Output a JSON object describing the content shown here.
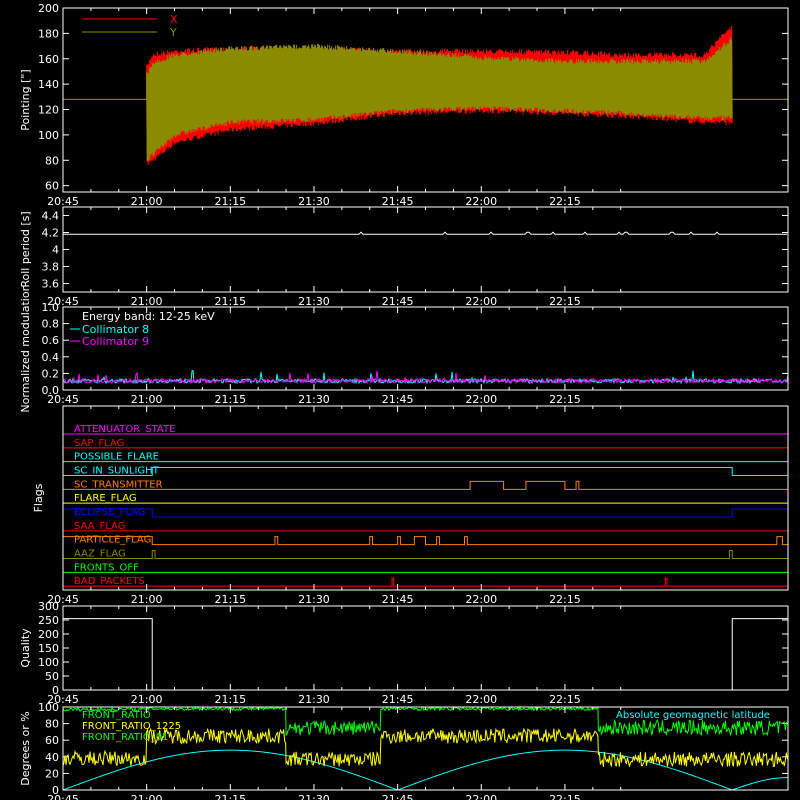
{
  "time_axis": {
    "tick_labels": [
      "20:45",
      "21:00",
      "21:15",
      "21:30",
      "21:45",
      "22:00",
      "22:15"
    ],
    "range_min": [
      0,
      130
    ]
  },
  "chart_data": [
    {
      "type": "line",
      "panel": "pointing",
      "ylabel": "Pointing [\"]",
      "ylim": [
        55,
        200
      ],
      "yticks": [
        60,
        80,
        100,
        120,
        140,
        160,
        180,
        200
      ],
      "legend": "top-left",
      "series": [
        {
          "name": "X",
          "color": "#ff0000",
          "baseline": 128,
          "envelope": {
            "x_min": [
              15,
              16,
              20,
              30,
              45,
              60,
              75,
              90,
              100,
              115,
              120
            ],
            "upper": [
              155,
              165,
              168,
              170,
              170,
              168,
              168,
              167,
              165,
              165,
              188
            ],
            "lower": [
              75,
              78,
              92,
              102,
              107,
              115,
              117,
              115,
              113,
              108,
              108
            ]
          }
        },
        {
          "name": "Y",
          "color": "#8b8b00",
          "baseline": 128,
          "envelope": {
            "x_min": [
              15,
              16,
              20,
              30,
              45,
              60,
              75,
              90,
              100,
              115,
              120
            ],
            "upper": [
              150,
              158,
              165,
              170,
              172,
              168,
              163,
              160,
              160,
              160,
              178
            ],
            "lower": [
              78,
              82,
              98,
              108,
              110,
              117,
              119,
              117,
              115,
              111,
              111
            ]
          }
        }
      ]
    },
    {
      "type": "line",
      "panel": "roll",
      "ylabel": "Roll period [s]",
      "ylim": [
        3.5,
        4.5
      ],
      "yticks": [
        3.6,
        3.8,
        4.0,
        4.2,
        4.4
      ],
      "series": [
        {
          "name": "",
          "color": "#ffffff",
          "values_constant": 4.18
        }
      ]
    },
    {
      "type": "line",
      "panel": "modulation",
      "ylabel": "Normalized modulation",
      "ylim": [
        0,
        1.0
      ],
      "yticks": [
        0.0,
        0.2,
        0.4,
        0.6,
        0.8,
        1.0
      ],
      "annotations": [
        "Energy band: 12-25 keV"
      ],
      "legend": "top-left",
      "series": [
        {
          "name": "Collimator 8",
          "color": "#00ffff",
          "mean": 0.1
        },
        {
          "name": "Collimator 9",
          "color": "#ff00ff",
          "mean": 0.1
        }
      ]
    },
    {
      "type": "line",
      "panel": "flags",
      "ylabel": "Flags",
      "series": [
        {
          "name": "ATTENUATOR_STATE",
          "color": "#ff00ff",
          "on": []
        },
        {
          "name": "SAP_FLAG",
          "color": "#ff0000",
          "on": []
        },
        {
          "name": "POSSIBLE_FLARE",
          "color": "#00ffff",
          "on": []
        },
        {
          "name": "SC_IN_SUNLIGHT",
          "color": "#00ffff",
          "on": [
            [
              16,
              120
            ]
          ]
        },
        {
          "name": "SC_TRANSMITTER",
          "color": "#ff8000",
          "on": [
            [
              73,
              79
            ],
            [
              83,
              90
            ],
            [
              92,
              92.5
            ]
          ]
        },
        {
          "name": "FLARE_FLAG",
          "color": "#ffff00",
          "on": []
        },
        {
          "name": "ECLIPSE_FLAG",
          "color": "#0000ff",
          "on": [
            [
              0,
              16
            ],
            [
              120,
              130
            ]
          ]
        },
        {
          "name": "SAA_FLAG",
          "color": "#ff0000",
          "on": []
        },
        {
          "name": "PARTICLE_FLAG",
          "color": "#ff8000",
          "on": [
            [
              0,
              16
            ],
            [
              38,
              38.5
            ],
            [
              55,
              55.5
            ],
            [
              60,
              60.5
            ],
            [
              63,
              65
            ],
            [
              67,
              67.5
            ],
            [
              72,
              72.5
            ],
            [
              128,
              129
            ]
          ]
        },
        {
          "name": "AAZ_FLAG",
          "color": "#8b8b00",
          "on": [
            [
              16,
              16.5
            ],
            [
              119.5,
              120
            ]
          ]
        },
        {
          "name": "FRONTS_OFF",
          "color": "#00ff00",
          "on": []
        },
        {
          "name": "BAD_PACKETS",
          "color": "#ff0000",
          "on": [
            [
              59,
              59.3
            ],
            [
              108,
              108.3
            ]
          ]
        }
      ]
    },
    {
      "type": "line",
      "panel": "quality",
      "ylabel": "Quality",
      "ylim": [
        0,
        300
      ],
      "yticks": [
        0,
        50,
        100,
        150,
        200,
        250,
        300
      ],
      "series": [
        {
          "name": "",
          "color": "#ffffff",
          "steps": [
            [
              0,
              255
            ],
            [
              16,
              0
            ],
            [
              120,
              255
            ],
            [
              130,
              255
            ]
          ]
        }
      ]
    },
    {
      "type": "line",
      "panel": "ratios",
      "ylabel": "Degrees or %",
      "ylim": [
        0,
        100
      ],
      "yticks": [
        0,
        20,
        40,
        60,
        80,
        100
      ],
      "legend": "top-left",
      "series": [
        {
          "name": "FRONT_RATIO",
          "color": "#00ff00",
          "segments": [
            [
              0,
              15,
              97
            ],
            [
              15,
              40,
              98
            ],
            [
              40,
              57,
              75
            ],
            [
              57,
              96,
              98
            ],
            [
              96,
              130,
              75
            ]
          ]
        },
        {
          "name": "FRONT_RATIO_1225",
          "color": "#ffff00",
          "segments": [
            [
              0,
              15,
              38
            ],
            [
              15,
              40,
              65
            ],
            [
              40,
              57,
              37
            ],
            [
              57,
              96,
              65
            ],
            [
              96,
              130,
              37
            ]
          ]
        },
        {
          "name": "FRONT_RATIO_01",
          "color": "#ffffff",
          "segments": []
        },
        {
          "name": "Absolute geomagnetic latitude",
          "color": "#00ffff",
          "points": [
            [
              0,
              0
            ],
            [
              30,
              48
            ],
            [
              60,
              0
            ],
            [
              90,
              48
            ],
            [
              120,
              0
            ],
            [
              130,
              15
            ]
          ]
        }
      ],
      "legend_labels_raw": [
        "FRONT_RATIO",
        "FRONT_RATIO_1225",
        "FRONT_RATIO_01",
        "Absolute geomagnetic latitude"
      ]
    }
  ]
}
